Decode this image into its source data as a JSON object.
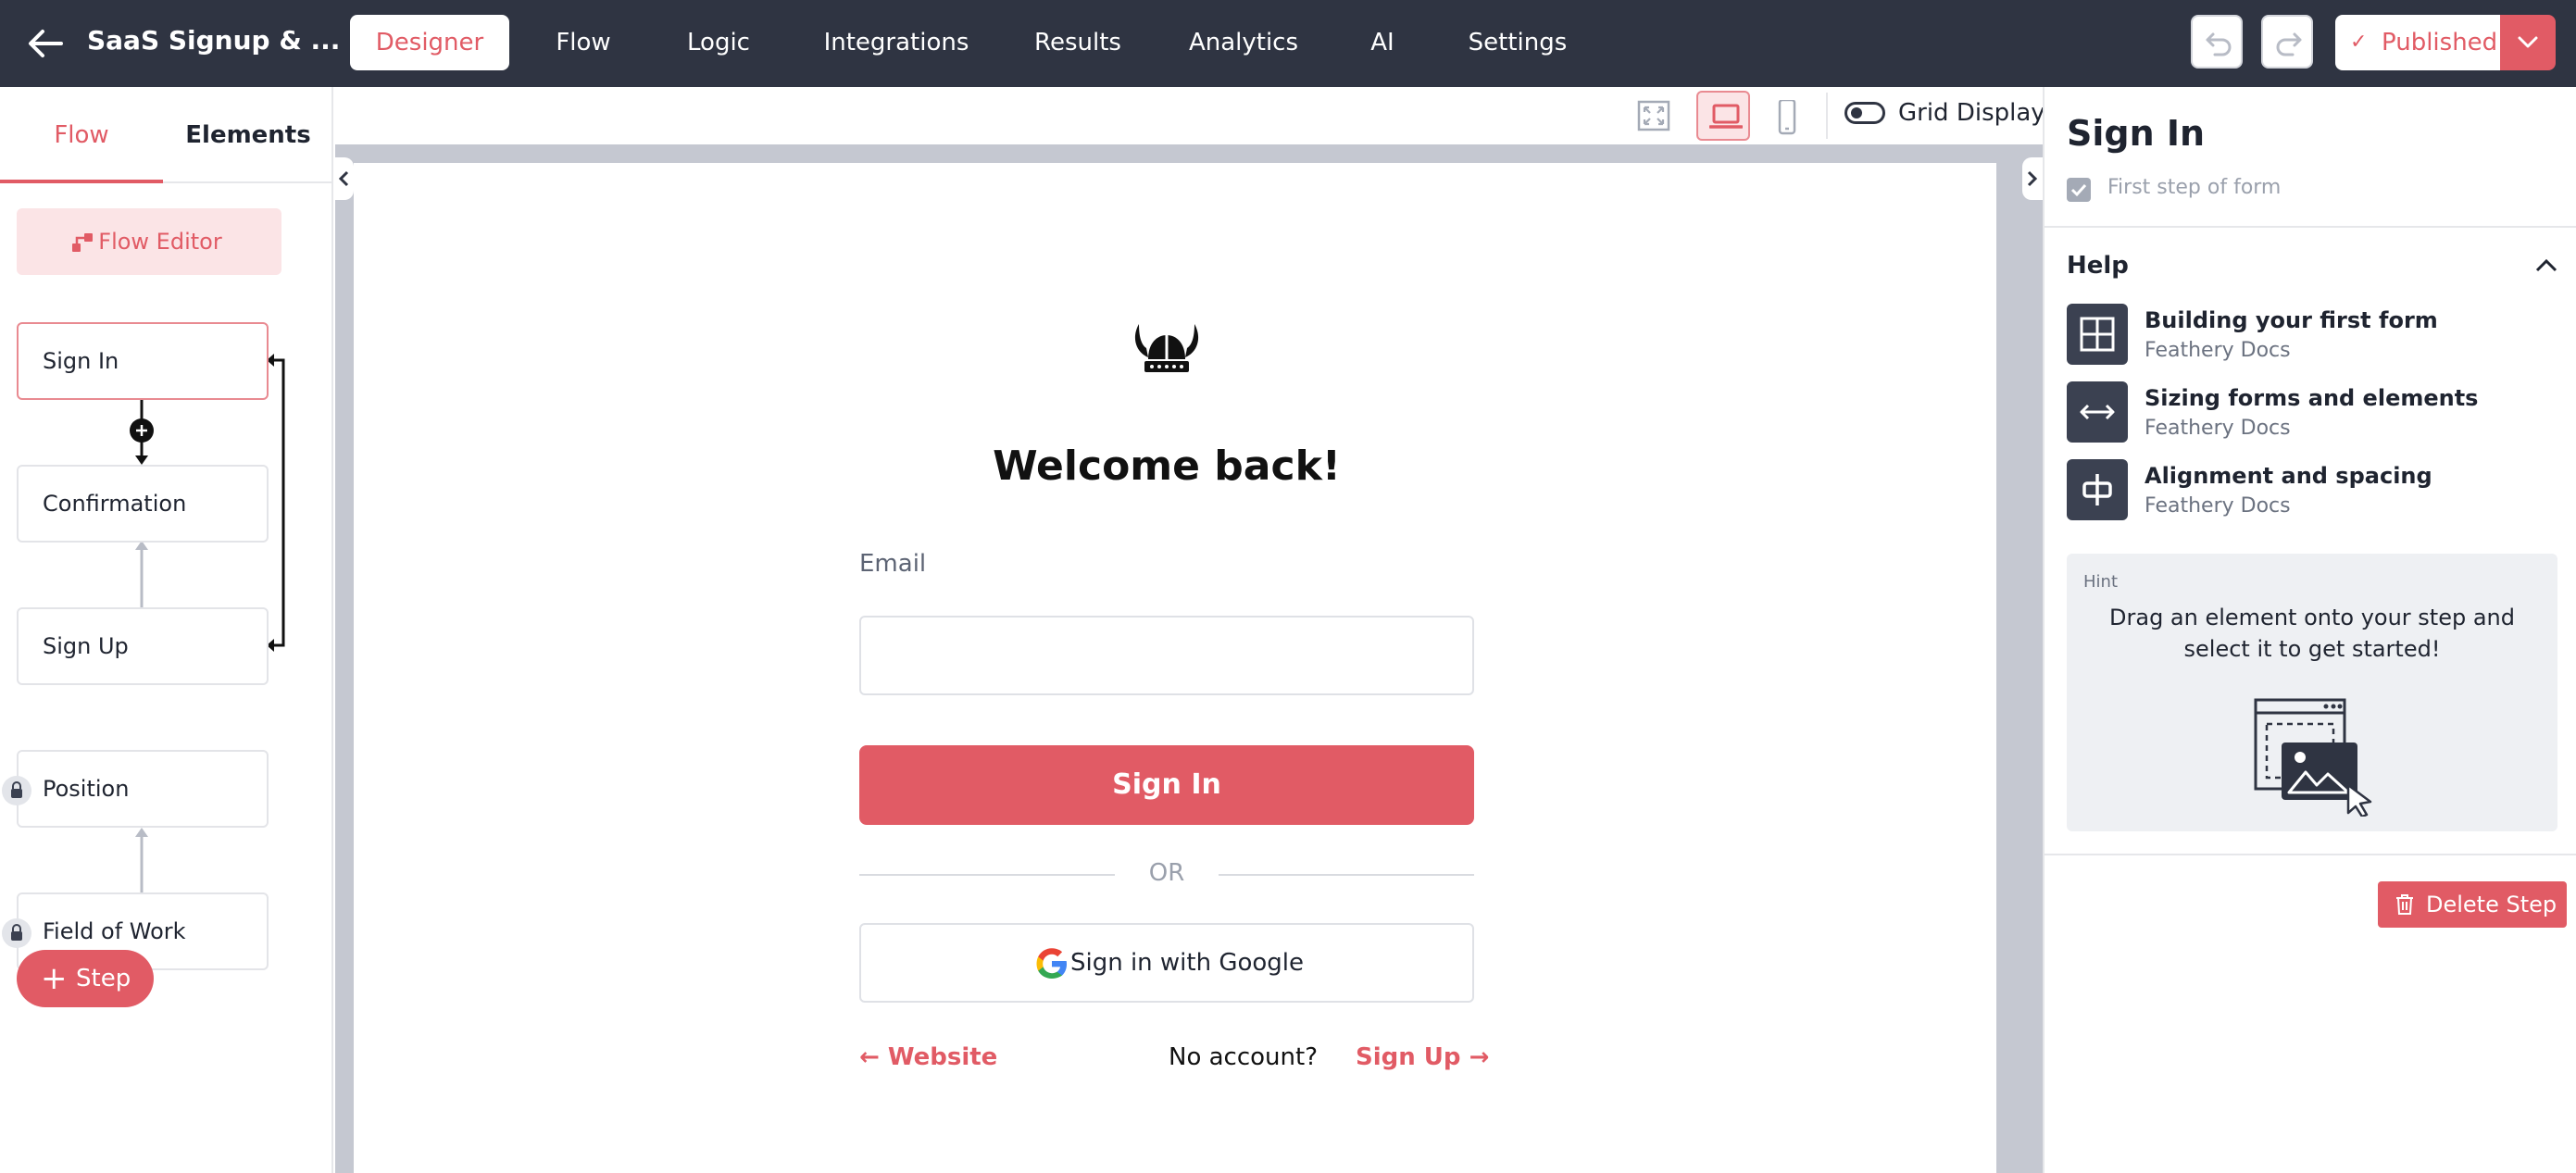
{
  "app": {
    "title": "SaaS Signup & ..."
  },
  "nav": {
    "tabs": [
      {
        "label": "Designer",
        "active": true
      },
      {
        "label": "Flow"
      },
      {
        "label": "Logic"
      },
      {
        "label": "Integrations"
      },
      {
        "label": "Results"
      },
      {
        "label": "Analytics"
      },
      {
        "label": "AI"
      },
      {
        "label": "Settings"
      }
    ],
    "publish_label": "Published"
  },
  "left_panel": {
    "tabs": {
      "flow": "Flow",
      "elements": "Elements"
    },
    "flow_editor_label": "Flow Editor",
    "steps": [
      {
        "label": "Sign In",
        "selected": true
      },
      {
        "label": "Confirmation"
      },
      {
        "label": "Sign Up"
      },
      {
        "label": "Position",
        "locked": true
      },
      {
        "label": "Field of Work",
        "locked": true
      }
    ],
    "add_step_label": "Step"
  },
  "canvas": {
    "grid_label": "Grid Display",
    "form": {
      "heading": "Welcome back!",
      "email_label": "Email",
      "email_value": "",
      "signin_label": "Sign In",
      "or_label": "OR",
      "google_label": "Sign in with Google",
      "website_label": "Website",
      "no_account_label": "No account?",
      "signup_label": "Sign Up"
    }
  },
  "right_panel": {
    "title": "Sign In",
    "first_step_label": "First step of form",
    "help_title": "Help",
    "help_items": [
      {
        "title": "Building your first form",
        "source": "Feathery Docs",
        "icon": "layout-icon"
      },
      {
        "title": "Sizing forms and elements",
        "source": "Feathery Docs",
        "icon": "resize-icon"
      },
      {
        "title": "Alignment and spacing",
        "source": "Feathery Docs",
        "icon": "align-icon"
      }
    ],
    "hint_label": "Hint",
    "hint_text": "Drag an element onto your step and select it to get started!",
    "delete_label": "Delete Step"
  },
  "colors": {
    "accent": "#e15b65",
    "topbar": "#2f3442",
    "canvas_bg": "#c5c8d1"
  }
}
